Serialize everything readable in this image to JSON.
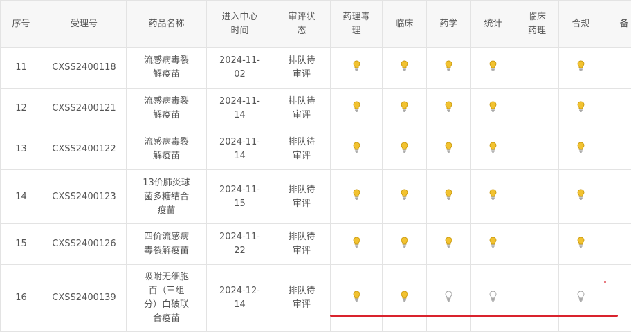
{
  "headers": [
    "序号",
    "受理号",
    "药品名称",
    "进入中心时间",
    "审评状态",
    "药理毒理",
    "临床",
    "药学",
    "统计",
    "临床药理",
    "合规",
    "备"
  ],
  "header_lines": {
    "h3": [
      "进入中心",
      "时间"
    ],
    "h4": [
      "审评状",
      "态"
    ],
    "h5": [
      "药理毒",
      "理"
    ],
    "h9": [
      "临床",
      "药理"
    ]
  },
  "rows": [
    {
      "no": "11",
      "id": "CXSS2400118",
      "name": [
        "流感病毒裂",
        "解疫苗"
      ],
      "date": [
        "2024-11-",
        "02"
      ],
      "status": [
        "排队待",
        "审评"
      ],
      "bulbs": [
        "on",
        "on",
        "on",
        "on",
        "",
        "on"
      ]
    },
    {
      "no": "12",
      "id": "CXSS2400121",
      "name": [
        "流感病毒裂",
        "解疫苗"
      ],
      "date": [
        "2024-11-",
        "14"
      ],
      "status": [
        "排队待",
        "审评"
      ],
      "bulbs": [
        "on",
        "on",
        "on",
        "on",
        "",
        "on"
      ]
    },
    {
      "no": "13",
      "id": "CXSS2400122",
      "name": [
        "流感病毒裂",
        "解疫苗"
      ],
      "date": [
        "2024-11-",
        "14"
      ],
      "status": [
        "排队待",
        "审评"
      ],
      "bulbs": [
        "on",
        "on",
        "on",
        "on",
        "",
        "on"
      ]
    },
    {
      "no": "14",
      "id": "CXSS2400123",
      "name": [
        "13价肺炎球",
        "菌多糖结合",
        "疫苗"
      ],
      "date": [
        "2024-11-",
        "15"
      ],
      "status": [
        "排队待",
        "审评"
      ],
      "bulbs": [
        "on",
        "on",
        "on",
        "on",
        "",
        "on"
      ]
    },
    {
      "no": "15",
      "id": "CXSS2400126",
      "name": [
        "四价流感病",
        "毒裂解疫苗"
      ],
      "date": [
        "2024-11-",
        "22"
      ],
      "status": [
        "排队待",
        "审评"
      ],
      "bulbs": [
        "on",
        "on",
        "on",
        "on",
        "",
        "on"
      ]
    },
    {
      "no": "16",
      "id": "CXSS2400139",
      "name": [
        "吸附无细胞",
        "百（三组",
        "分）白破联",
        "合疫苗"
      ],
      "date": [
        "2024-12-",
        "14"
      ],
      "status": [
        "排队待",
        "审评"
      ],
      "bulbs": [
        "on",
        "on",
        "off",
        "off",
        "",
        "off"
      ]
    }
  ],
  "colors": {
    "bulb_on": "#f2c230",
    "bulb_off": "#ffffff",
    "annotation": "#d9232d"
  },
  "icons": {
    "bulb": "lightbulb-icon"
  }
}
